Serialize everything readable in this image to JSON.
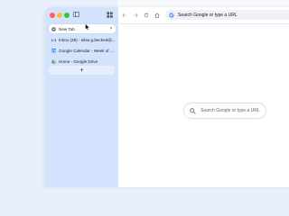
{
  "sidebar": {
    "tabs": [
      {
        "label": "New Tab",
        "icon": "chrome-icon",
        "active": true,
        "close_label": "×"
      },
      {
        "label": "Inbox (38) - elise.g.beckett@...",
        "icon": "gmail-icon",
        "active": false
      },
      {
        "label": "Google Calendar - Week of M...",
        "icon": "calendar-icon",
        "active": false
      },
      {
        "label": "Home - Google Drive",
        "icon": "drive-icon",
        "active": false
      }
    ],
    "new_tab_label": "+"
  },
  "toolbar": {
    "omnibox_placeholder": "Search Google or type a URL"
  },
  "page": {
    "search_placeholder": "Search Google or type a URL"
  },
  "colors": {
    "sidebar_bg": "#d3e3fd",
    "accent": "#1a73e8"
  }
}
